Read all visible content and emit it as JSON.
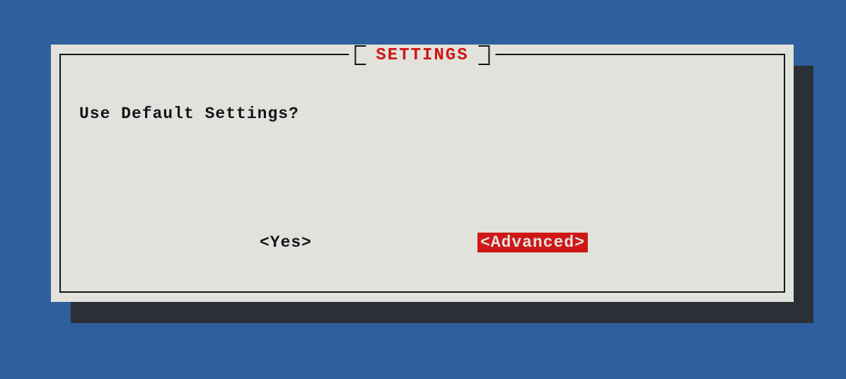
{
  "dialog": {
    "title": "SETTINGS",
    "prompt": "Use Default Settings?",
    "buttons": {
      "yes": "<Yes>",
      "advanced": "<Advanced>"
    }
  }
}
